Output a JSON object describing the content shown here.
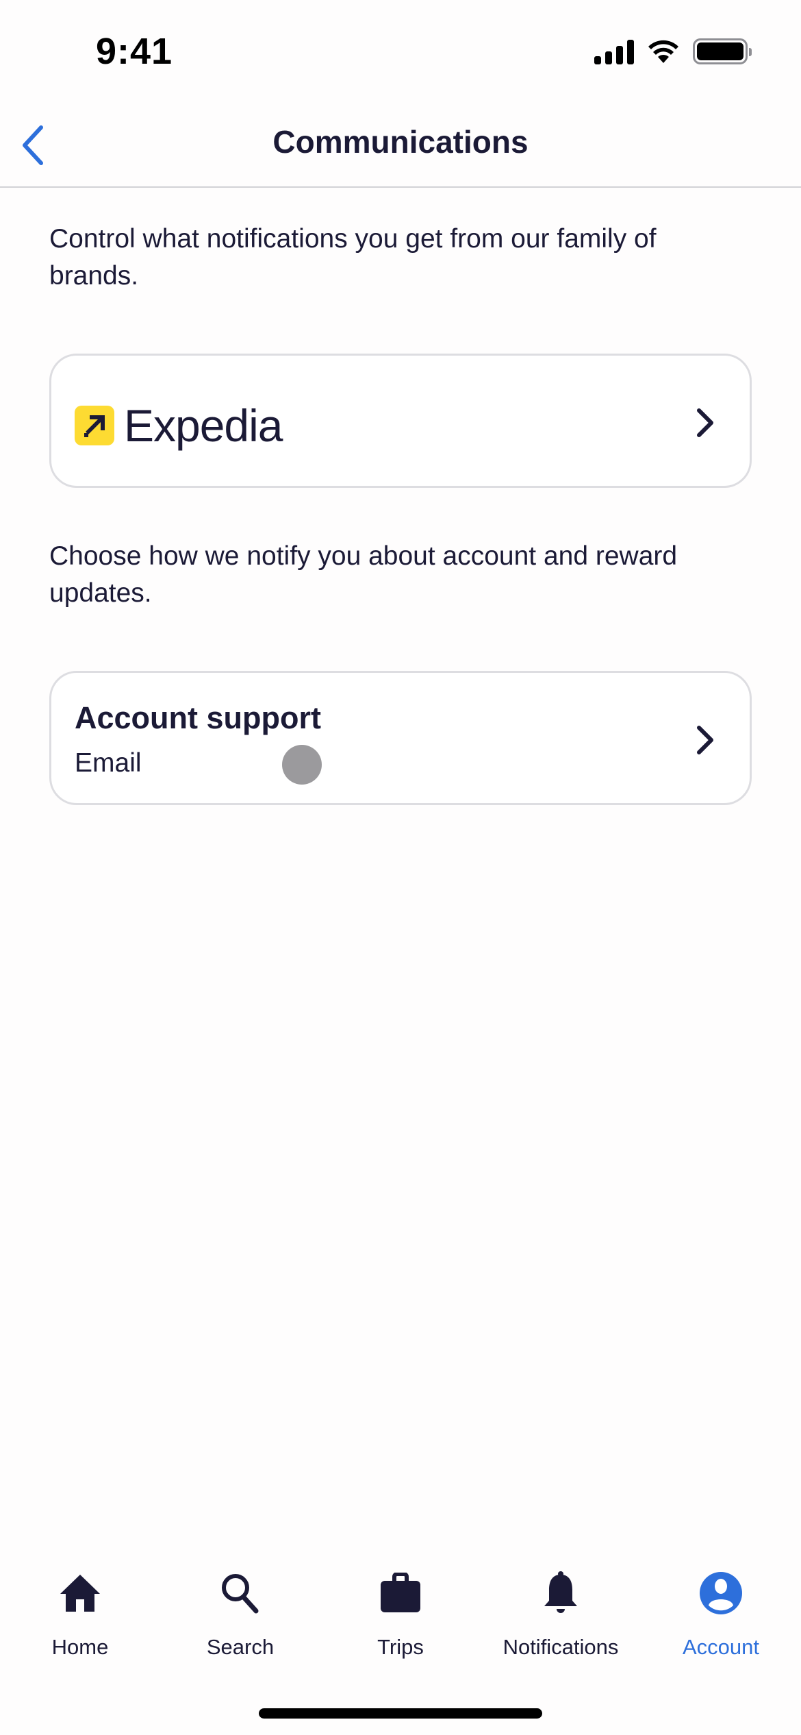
{
  "status_bar": {
    "time": "9:41"
  },
  "nav": {
    "title": "Communications",
    "back_icon": "chevron-left-icon"
  },
  "intro_text": "Control what notifications you get from our family of brands.",
  "brand_card": {
    "brand_name": "Expedia",
    "logo_color": "#fddb32"
  },
  "account_intro_text": "Choose how we notify you about account and reward updates.",
  "account_card": {
    "title": "Account support",
    "subtitle": "Email"
  },
  "tab_bar": {
    "items": [
      {
        "label": "Home",
        "icon": "home-icon",
        "active": false
      },
      {
        "label": "Search",
        "icon": "search-icon",
        "active": false
      },
      {
        "label": "Trips",
        "icon": "briefcase-icon",
        "active": false
      },
      {
        "label": "Notifications",
        "icon": "bell-icon",
        "active": false
      },
      {
        "label": "Account",
        "icon": "account-icon",
        "active": true
      }
    ]
  },
  "colors": {
    "accent": "#2d6fdb",
    "text": "#1b1a36",
    "brand_yellow": "#fddb32"
  }
}
